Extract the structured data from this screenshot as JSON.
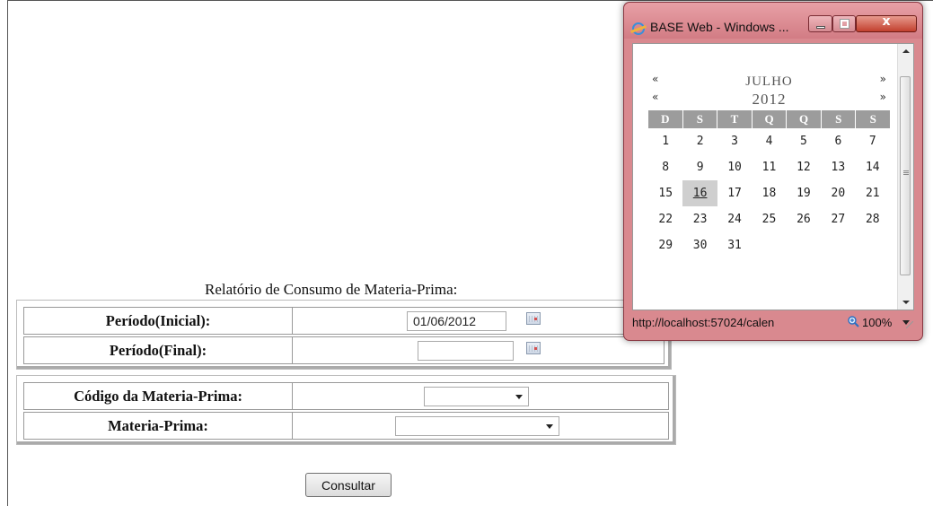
{
  "report": {
    "title": "Relatório de Consumo de Materia-Prima:",
    "periodo_inicial_label": "Período(Inicial):",
    "periodo_inicial_value": "01/06/2012",
    "periodo_final_label": "Período(Final):",
    "periodo_final_value": "",
    "codigo_label": "Código da Materia-Prima:",
    "codigo_value": "",
    "materia_label": "Materia-Prima:",
    "materia_value": "",
    "submit_label": "Consultar"
  },
  "popup": {
    "title": "BASE Web - Windows ...",
    "status_url": "http://localhost:57024/calen",
    "zoom": "100%",
    "icons": {
      "app": "ie-icon",
      "minimize": "minimize-icon",
      "maximize": "maximize-icon",
      "close": "close-icon",
      "zoom": "zoom-icon"
    },
    "calendar": {
      "prev_month": "«",
      "next_month": "»",
      "prev_year": "«",
      "next_year": "»",
      "month": "JULHO",
      "year": "2012",
      "weekdays": [
        "D",
        "S",
        "T",
        "Q",
        "Q",
        "S",
        "S"
      ],
      "days": [
        [
          "1",
          "2",
          "3",
          "4",
          "5",
          "6",
          "7"
        ],
        [
          "8",
          "9",
          "10",
          "11",
          "12",
          "13",
          "14"
        ],
        [
          "15",
          "16",
          "17",
          "18",
          "19",
          "20",
          "21"
        ],
        [
          "22",
          "23",
          "24",
          "25",
          "26",
          "27",
          "28"
        ],
        [
          "29",
          "30",
          "31",
          "",
          "",
          "",
          ""
        ]
      ],
      "selected_day": "16"
    }
  },
  "colors": {
    "window_frame": "#d9898f",
    "header_gray": "#9c9c9c",
    "selected_day_bg": "#cfcfcf"
  }
}
